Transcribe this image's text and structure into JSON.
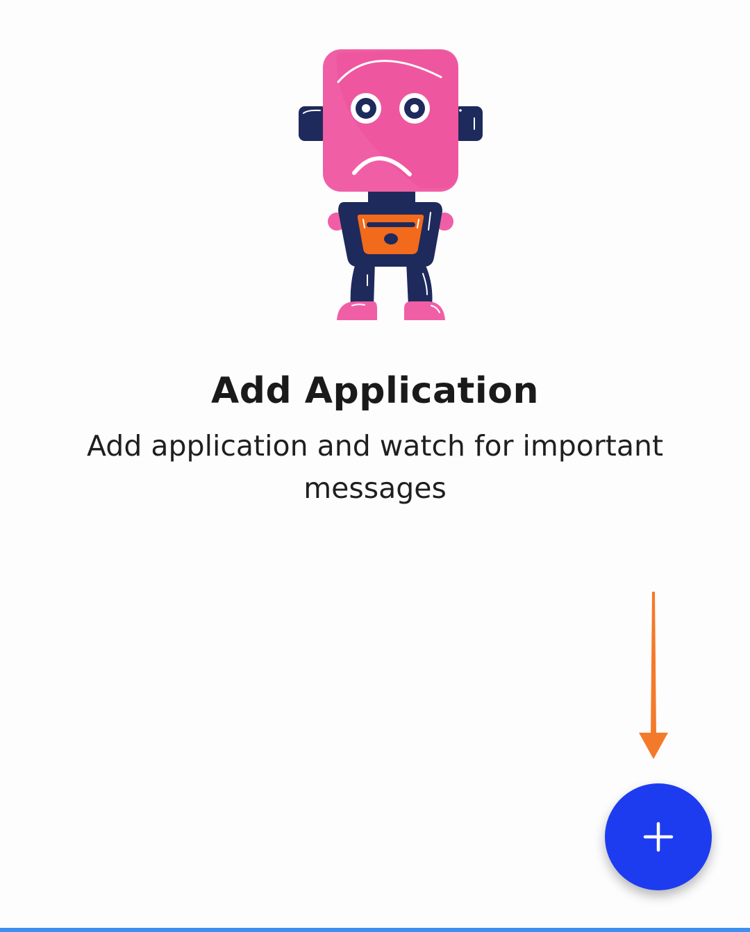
{
  "empty_state": {
    "illustration": "sad-robot-illustration",
    "title": "Add Application",
    "message": "Add application and watch for important messages"
  },
  "fab": {
    "icon": "plus-icon",
    "color": "#1d3cf0"
  },
  "hint_arrow": {
    "icon": "arrow-down-icon",
    "color": "#f47a2b"
  },
  "colors": {
    "robot_head": "#f05fa5",
    "robot_body": "#1e2a5c",
    "robot_chest": "#f26a1b",
    "bottom_bar": "#3d8ff0"
  }
}
